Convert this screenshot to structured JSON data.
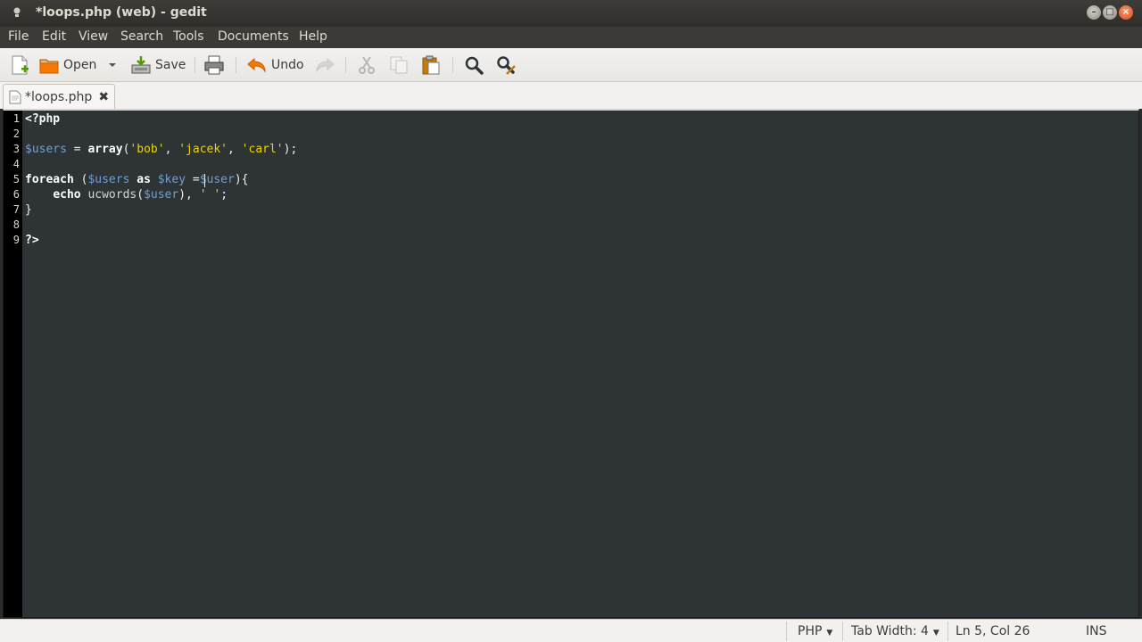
{
  "window": {
    "title": "*loops.php (web) - gedit"
  },
  "menubar": {
    "items": [
      "File",
      "Edit",
      "View",
      "Search",
      "Tools",
      "Documents",
      "Help"
    ]
  },
  "toolbar": {
    "new_icon": "new-document-icon",
    "open_label": "Open",
    "save_label": "Save",
    "undo_label": "Undo",
    "icons": [
      "new-document-icon",
      "open-folder-icon",
      "save-icon",
      "print-icon",
      "undo-icon",
      "redo-icon",
      "cut-icon",
      "copy-icon",
      "paste-icon",
      "search-icon",
      "replace-icon"
    ]
  },
  "tabs": [
    {
      "label": "*loops.php"
    }
  ],
  "editor": {
    "line_numbers": [
      "1",
      "2",
      "3",
      "4",
      "5",
      "6",
      "7",
      "8",
      "9"
    ],
    "lines": [
      [
        {
          "t": "<?php",
          "c": "kw"
        }
      ],
      [],
      [
        {
          "t": "$users",
          "c": "var"
        },
        {
          "t": " = ",
          "c": ""
        },
        {
          "t": "array",
          "c": "kw"
        },
        {
          "t": "(",
          "c": ""
        },
        {
          "t": "'bob'",
          "c": "str"
        },
        {
          "t": ", ",
          "c": ""
        },
        {
          "t": "'jacek'",
          "c": "str"
        },
        {
          "t": ", ",
          "c": ""
        },
        {
          "t": "'carl'",
          "c": "str"
        },
        {
          "t": ");",
          "c": ""
        }
      ],
      [],
      [
        {
          "t": "foreach",
          "c": "kw"
        },
        {
          "t": " (",
          "c": ""
        },
        {
          "t": "$users",
          "c": "var"
        },
        {
          "t": " ",
          "c": ""
        },
        {
          "t": "as",
          "c": "kw"
        },
        {
          "t": " ",
          "c": ""
        },
        {
          "t": "$key",
          "c": "var"
        },
        {
          "t": " =",
          "c": ""
        },
        {
          "t": "$user",
          "c": "var"
        },
        {
          "t": "){",
          "c": ""
        }
      ],
      [
        {
          "t": "    ",
          "c": ""
        },
        {
          "t": "echo",
          "c": "kw"
        },
        {
          "t": " ",
          "c": ""
        },
        {
          "t": "ucwords",
          "c": "fn"
        },
        {
          "t": "(",
          "c": ""
        },
        {
          "t": "$user",
          "c": "var"
        },
        {
          "t": "), ",
          "c": ""
        },
        {
          "t": "' '",
          "c": "str"
        },
        {
          "t": ";",
          "c": ""
        }
      ],
      [
        {
          "t": "}",
          "c": ""
        }
      ],
      [],
      [
        {
          "t": "?>",
          "c": "kw"
        }
      ]
    ]
  },
  "statusbar": {
    "language": "PHP",
    "tab_width": "Tab Width: 4",
    "position": "Ln 5, Col 26",
    "mode": "INS"
  },
  "colors": {
    "editor_bg": "#2e3436",
    "variable": "#729fcf",
    "string": "#edd400",
    "close_button": "#dd4814"
  }
}
